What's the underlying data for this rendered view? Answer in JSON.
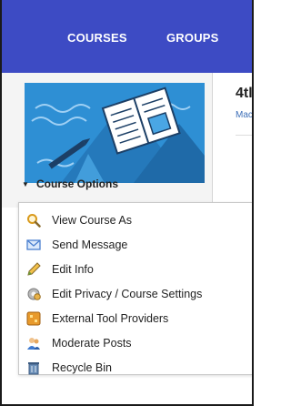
{
  "nav": {
    "courses_label": "COURSES",
    "groups_label": "GROUPS"
  },
  "sidebar": {
    "course_options_label": "Course Options"
  },
  "content": {
    "title_partial": "4tl",
    "subtitle_partial": "Mac"
  },
  "menu": {
    "items": [
      {
        "label": "View Course As",
        "icon": "magnifier-icon"
      },
      {
        "label": "Send Message",
        "icon": "envelope-icon"
      },
      {
        "label": "Edit Info",
        "icon": "pencil-icon"
      },
      {
        "label": "Edit Privacy / Course Settings",
        "icon": "gear-icon"
      },
      {
        "label": "External Tool Providers",
        "icon": "puzzle-icon"
      },
      {
        "label": "Moderate Posts",
        "icon": "users-icon"
      },
      {
        "label": "Recycle Bin",
        "icon": "recycle-bin-icon"
      }
    ]
  },
  "colors": {
    "nav_bg": "#3d4bc4",
    "banner_bg": "#2e8fd4",
    "link": "#3d6fb8"
  }
}
